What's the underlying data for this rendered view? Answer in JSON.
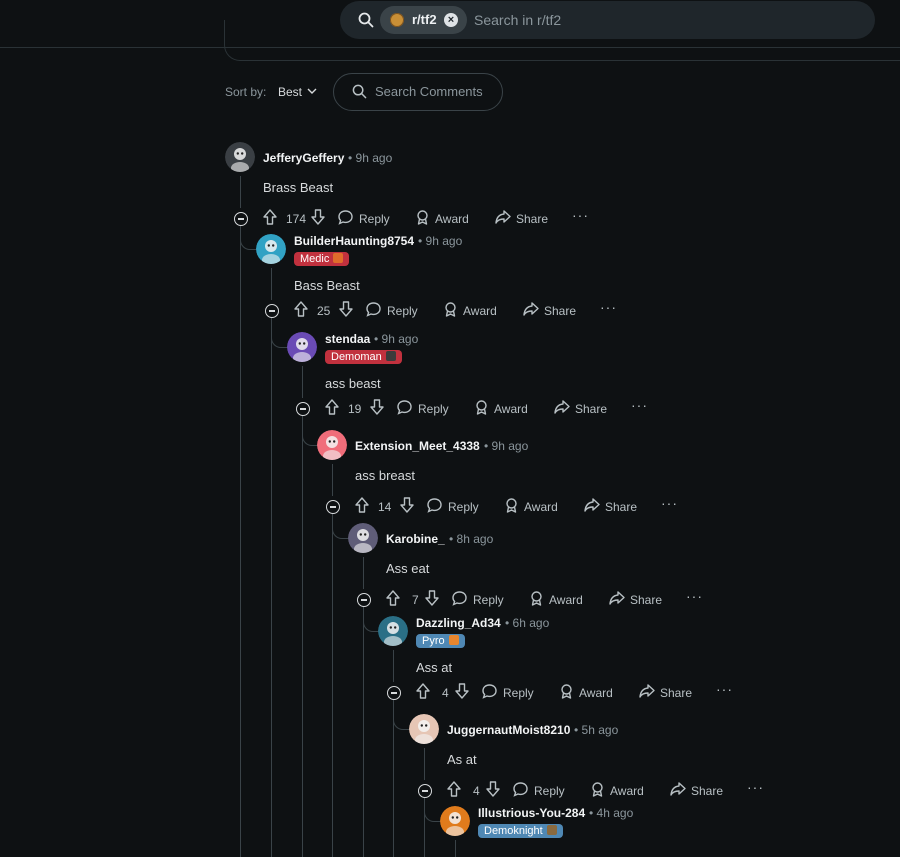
{
  "header": {
    "search_chip": "r/tf2",
    "search_placeholder": "Search in r/tf2"
  },
  "sort": {
    "label": "Sort by:",
    "value": "Best",
    "comment_search_placeholder": "Search Comments"
  },
  "action_labels": {
    "reply": "Reply",
    "award": "Award",
    "share": "Share",
    "more": "···"
  },
  "comments": [
    {
      "user": "JefferyGeffery",
      "time": "• 9h ago",
      "flair": null,
      "body": "Brass Beast",
      "score": "174",
      "avatar_color": "#3a3f44"
    },
    {
      "user": "BuilderHaunting8754",
      "time": "• 9h ago",
      "flair": {
        "text": "Medic",
        "color": "#c1313e",
        "emoji_color": "#e06c2b"
      },
      "body": "Bass Beast",
      "score": "25",
      "avatar_color": "#31a2c4"
    },
    {
      "user": "stendaa",
      "time": "• 9h ago",
      "flair": {
        "text": "Demoman",
        "color": "#c1313e",
        "emoji_color": "#3b3b3b"
      },
      "body": "ass beast",
      "score": "19",
      "avatar_color": "#6a4bb5"
    },
    {
      "user": "Extension_Meet_4338",
      "time": "• 9h ago",
      "flair": null,
      "body": "ass breast",
      "score": "14",
      "avatar_color": "#f06d7a"
    },
    {
      "user": "Karobine_",
      "time": "• 8h ago",
      "flair": null,
      "body": "Ass eat",
      "score": "7",
      "avatar_color": "#5f5d78"
    },
    {
      "user": "Dazzling_Ad34",
      "time": "• 6h ago",
      "flair": {
        "text": "Pyro",
        "color": "#4f88b4",
        "emoji_color": "#e8862e"
      },
      "body": "Ass at",
      "score": "4",
      "avatar_color": "#2a6f86"
    },
    {
      "user": "JuggernautMoist8210",
      "time": "• 5h ago",
      "flair": null,
      "body": "As at",
      "score": "4",
      "avatar_color": "#e6c6b5"
    },
    {
      "user": "Illustrious-You-284",
      "time": "• 4h ago",
      "flair": {
        "text": "Demoknight",
        "color": "#4f88b4",
        "emoji_color": "#8a6a3f"
      },
      "body": "",
      "score": "",
      "avatar_color": "#e07b1c"
    }
  ]
}
